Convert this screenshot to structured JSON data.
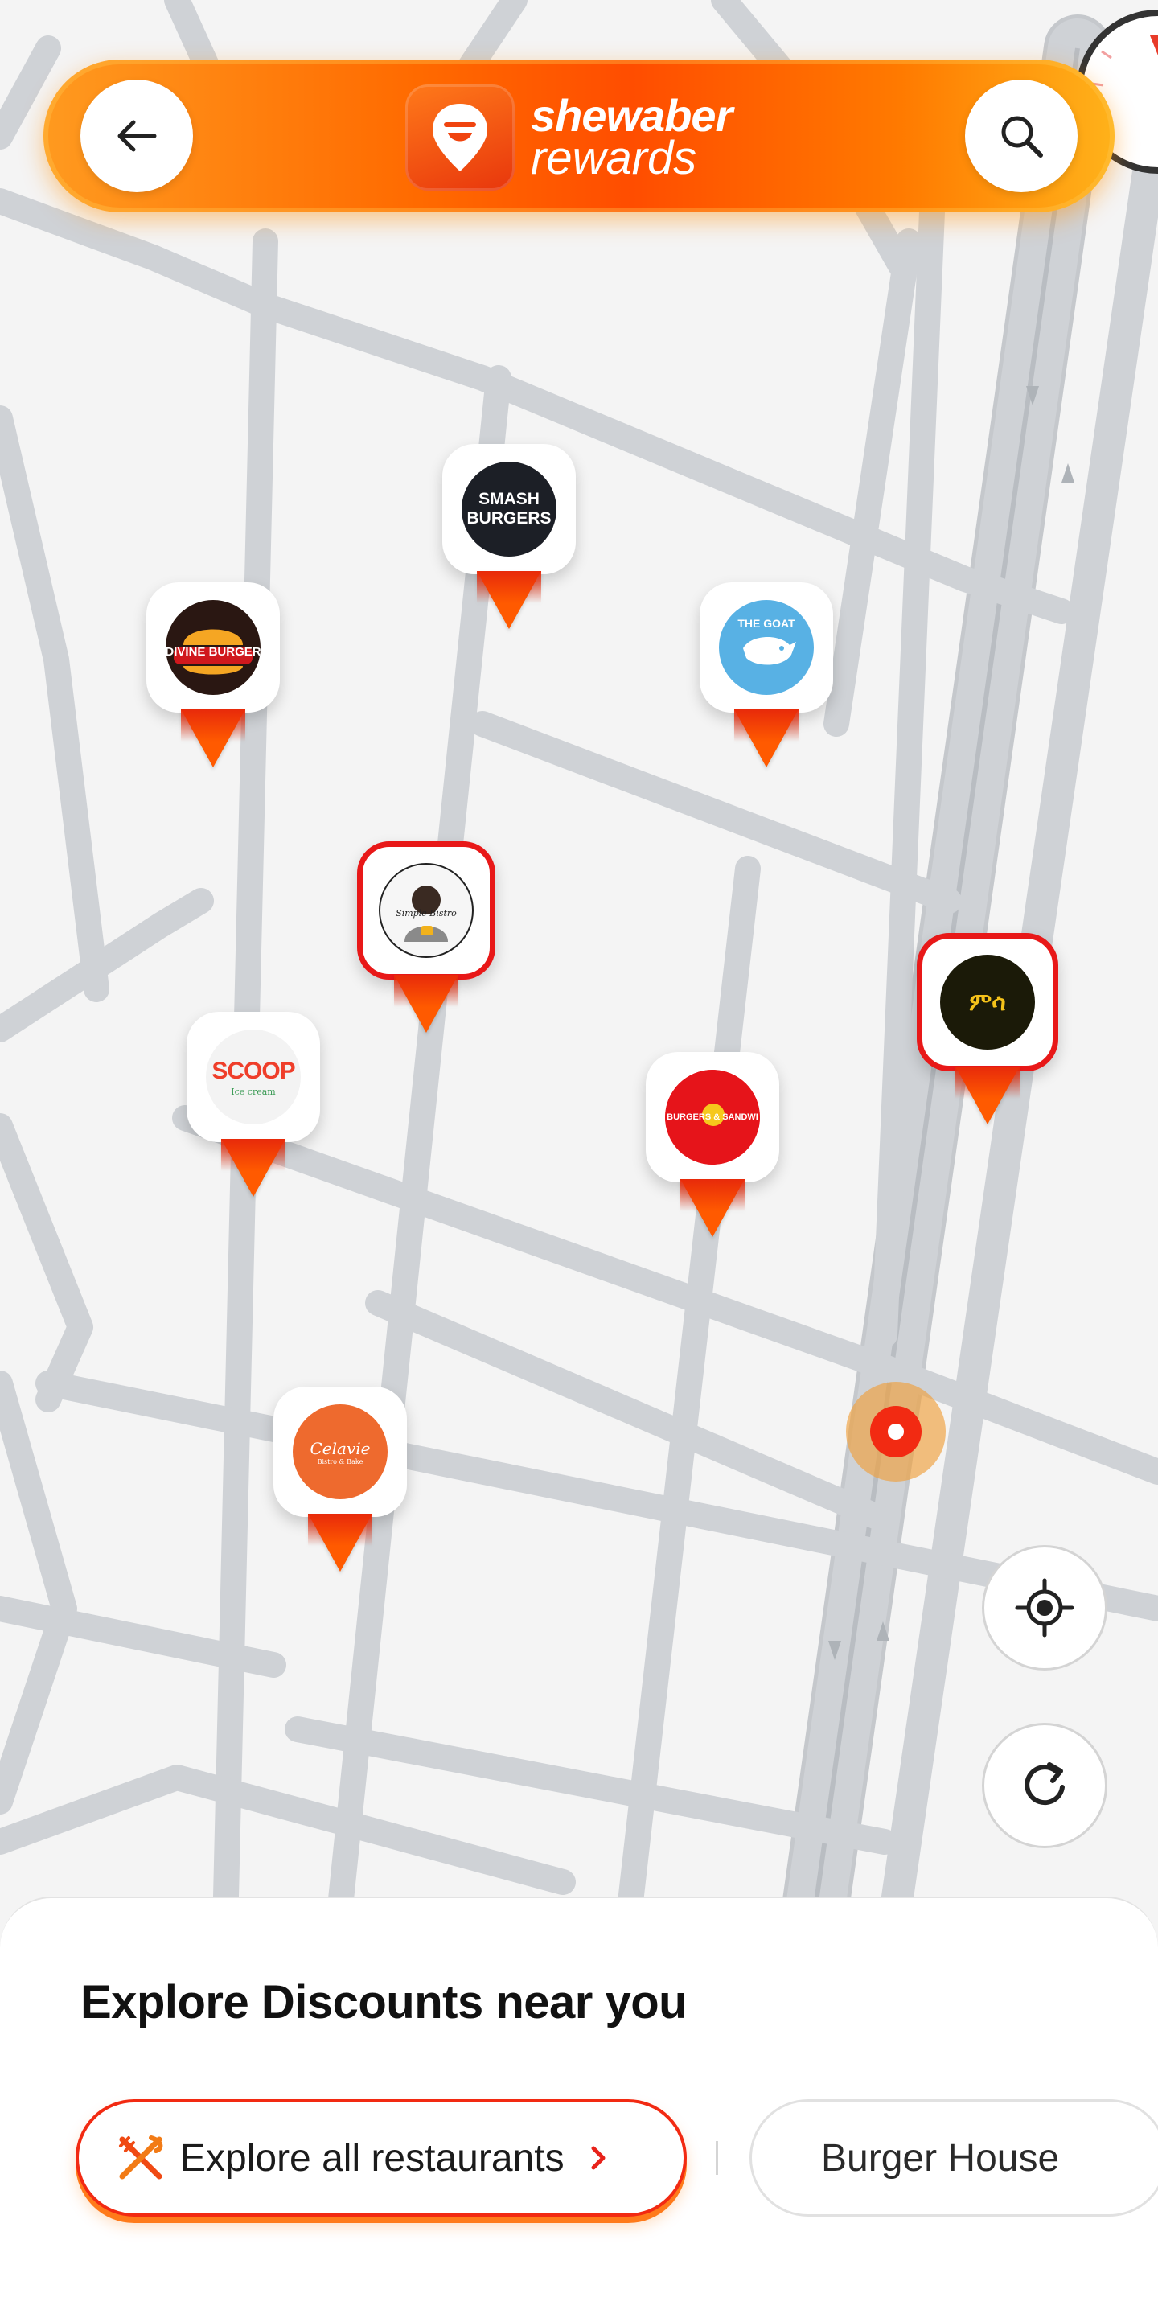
{
  "header": {
    "brand_name": "shewaber",
    "brand_sub": "rewards",
    "back_icon": "arrow-left-icon",
    "search_icon": "search-icon",
    "accent": "#ff5a00"
  },
  "map": {
    "pins": [
      {
        "id": "smash",
        "logo_text": "SMASH BURGERS",
        "selected": false
      },
      {
        "id": "divine",
        "logo_text": "DIVINE BURGER",
        "selected": false
      },
      {
        "id": "goat",
        "logo_text": "THE GOAT",
        "selected": false
      },
      {
        "id": "simple",
        "logo_text": "Simple Bistro",
        "selected": true
      },
      {
        "id": "scoop",
        "logo_text": "SCOOP",
        "logo_sub": "Ice cream",
        "selected": false
      },
      {
        "id": "burgers-sandwich",
        "logo_text": "BURGERS & SANDWI",
        "selected": false
      },
      {
        "id": "dark",
        "logo_text": "ምሳ",
        "selected": true
      },
      {
        "id": "celavie",
        "logo_text": "Celavie",
        "logo_sub": "Bistro & Bake",
        "selected": false
      }
    ],
    "controls": {
      "locate_icon": "crosshair-icon",
      "refresh_icon": "refresh-icon"
    }
  },
  "sheet": {
    "title": "Explore Discounts near you",
    "chips": [
      {
        "label": "Explore all restaurants",
        "icon": "fork-knife-icon",
        "active": true
      },
      {
        "label": "Burger House",
        "active": false
      }
    ]
  }
}
